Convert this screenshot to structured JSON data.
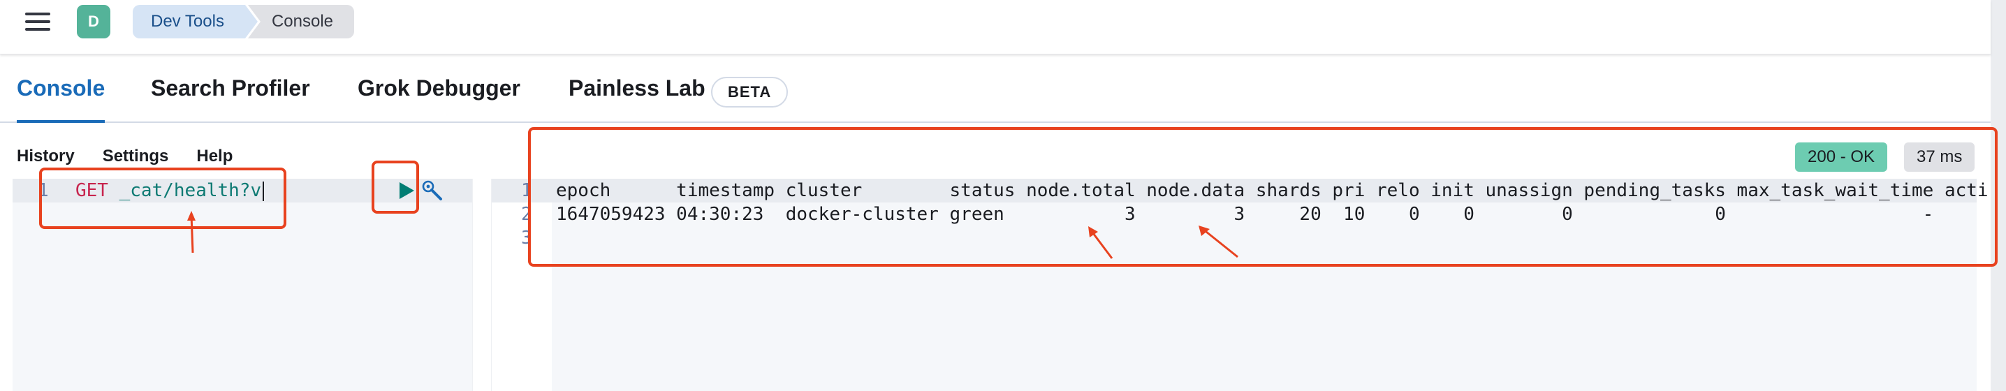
{
  "header": {
    "avatar_letter": "D",
    "breadcrumbs": [
      "Dev Tools",
      "Console"
    ]
  },
  "tabs": [
    {
      "label": "Console",
      "active": true
    },
    {
      "label": "Search Profiler",
      "active": false
    },
    {
      "label": "Grok Debugger",
      "active": false
    },
    {
      "label": "Painless Lab",
      "active": false
    }
  ],
  "beta_badge": "BETA",
  "menu": [
    "History",
    "Settings",
    "Help"
  ],
  "editor": {
    "line_numbers": [
      "1"
    ],
    "method": "GET",
    "path": "_cat/health?v"
  },
  "output": {
    "line_numbers": [
      "1",
      "2",
      "3"
    ],
    "lines": [
      "epoch      timestamp cluster        status node.total node.data shards pri relo init unassign pending_tasks max_task_wait_time acti",
      "1647059423 04:30:23  docker-cluster green           3         3     20  10    0    0        0             0                  -"
    ]
  },
  "status": {
    "code": "200 - OK",
    "duration": "37 ms"
  },
  "colors": {
    "accent": "#1a6bb8",
    "status_ok": "#6dccb1",
    "annotation": "#e8421f"
  }
}
